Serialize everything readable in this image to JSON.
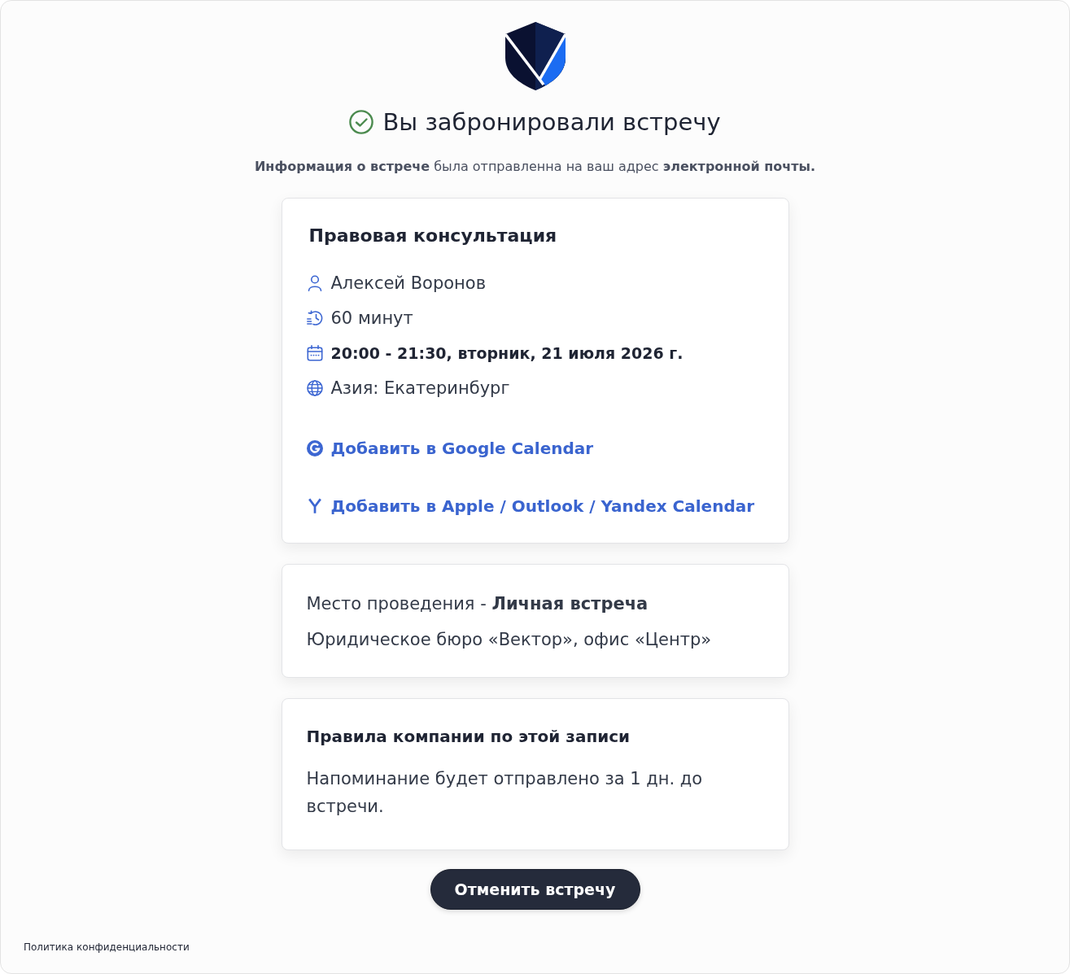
{
  "heading": "Вы забронировали встречу",
  "notice": "**Информация о встрече** была отправленна на ваш адрес **электронной почты.**",
  "booking": {
    "title": "Правовая консультация",
    "details": [
      {
        "kind": "person",
        "text": "Алексей Воронов"
      },
      {
        "kind": "duration",
        "text": "60 минут"
      },
      {
        "kind": "date",
        "text": "20:00 - 21:30, вторник, 21 июля 2026 г."
      },
      {
        "kind": "timezone",
        "text": "Азия: Екатеринбург"
      }
    ],
    "calendar_links": [
      {
        "kind": "google",
        "label": "Добавить в Google Calendar"
      },
      {
        "kind": "ics",
        "label": "Добавить в Apple / Outlook / Yandex Calendar"
      }
    ]
  },
  "location": {
    "label": "Место проведения - **Личная встреча**",
    "address": "Юридическое бюро «Вектор», офис «Центр»"
  },
  "rules": {
    "title": "Правила компании по этой записи",
    "text": "Напоминание будет отправлено за 1 дн. до встречи."
  },
  "cancel_button": "Отменить встречу",
  "footer": {
    "privacy_link": "Политика конфиденциальности"
  }
}
